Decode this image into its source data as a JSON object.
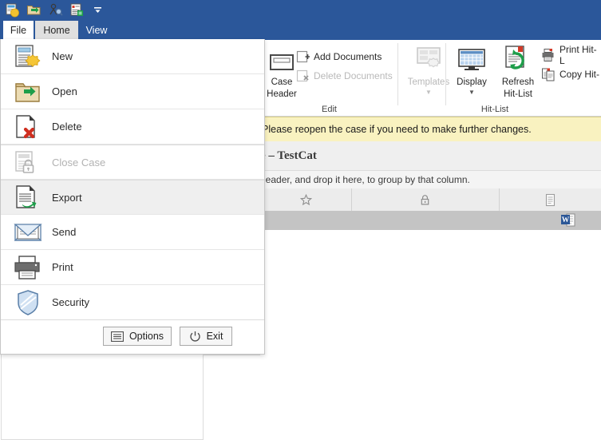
{
  "titlebar": {
    "quick_access": [
      {
        "name": "new-case-icon",
        "label": "New Case"
      },
      {
        "name": "open-case-icon",
        "label": "Open Case"
      },
      {
        "name": "search-person-icon",
        "label": "Search"
      },
      {
        "name": "report-icon",
        "label": "Report"
      },
      {
        "name": "customize-quick-access-icon",
        "label": "Customize Quick Access Toolbar"
      }
    ],
    "accent_color": "#2b579a"
  },
  "tabs": [
    {
      "id": "file",
      "label": "File",
      "state": "open"
    },
    {
      "id": "home",
      "label": "Home",
      "state": "selected"
    },
    {
      "id": "view",
      "label": "View",
      "state": "normal"
    }
  ],
  "ribbon": {
    "groups": [
      {
        "id": "edit",
        "label": "Edit",
        "big_buttons": [
          {
            "name": "case-header-button",
            "label_line1": "Case",
            "label_line2": "Header",
            "icon": "case-header-icon",
            "disabled": false
          }
        ],
        "small_buttons": [
          {
            "name": "add-documents-button",
            "label": "Add Documents",
            "icon": "add-document-icon",
            "disabled": false
          },
          {
            "name": "delete-documents-button",
            "label": "Delete Documents",
            "icon": "delete-document-icon",
            "disabled": true
          }
        ],
        "templates": {
          "name": "templates-button",
          "label": "Templates",
          "icon": "templates-icon",
          "disabled": true,
          "has_caret": true
        }
      },
      {
        "id": "hitlist",
        "label": "Hit-List",
        "big_buttons": [
          {
            "name": "display-button",
            "label_line1": "Display",
            "label_line2": "",
            "icon": "display-grid-icon",
            "disabled": false,
            "has_caret": true
          },
          {
            "name": "refresh-hit-list-button",
            "label_line1": "Refresh",
            "label_line2": "Hit-List",
            "icon": "refresh-hitlist-icon",
            "disabled": false
          }
        ],
        "small_buttons": [
          {
            "name": "print-hit-list-button",
            "label": "Print Hit-L",
            "icon": "printer-icon",
            "disabled": false
          },
          {
            "name": "copy-hit-list-button",
            "label": "Copy Hit-",
            "icon": "copy-icon",
            "disabled": false
          }
        ]
      }
    ]
  },
  "file_menu": {
    "items": [
      {
        "name": "menu-new",
        "label": "New",
        "icon": "new-document-icon",
        "disabled": false,
        "hover": false,
        "separator_above": false
      },
      {
        "name": "menu-open",
        "label": "Open",
        "icon": "open-folder-icon",
        "disabled": false,
        "hover": false,
        "separator_above": false
      },
      {
        "name": "menu-delete",
        "label": "Delete",
        "icon": "delete-document-icon",
        "disabled": false,
        "hover": false,
        "separator_above": false
      },
      {
        "name": "menu-close-case",
        "label": "Close Case",
        "icon": "close-case-lock-icon",
        "disabled": true,
        "hover": false,
        "separator_above": true
      },
      {
        "name": "menu-export",
        "label": "Export",
        "icon": "export-icon",
        "disabled": false,
        "hover": true,
        "separator_above": true
      },
      {
        "name": "menu-send",
        "label": "Send",
        "icon": "envelope-icon",
        "disabled": false,
        "hover": false,
        "separator_above": false
      },
      {
        "name": "menu-print",
        "label": "Print",
        "icon": "printer-icon",
        "disabled": false,
        "hover": false,
        "separator_above": false
      },
      {
        "name": "menu-security",
        "label": "Security",
        "icon": "shield-icon",
        "disabled": false,
        "hover": false,
        "separator_above": false
      }
    ],
    "footer": {
      "options_label": "Options",
      "exit_label": "Exit"
    }
  },
  "content": {
    "info_bar": {
      "message": "Please reopen the case if you need to make further changes.",
      "background": "#f9f2c0"
    },
    "case_title": "e – TestCat",
    "group_by_hint": "header, and drop it here, to group by that column.",
    "grid": {
      "columns": [
        {
          "name": "favorite-column",
          "icon": "star-icon",
          "header": ""
        },
        {
          "name": "locked-column",
          "icon": "lock-icon",
          "header": ""
        },
        {
          "name": "document-column",
          "icon": "document-icon",
          "header": ""
        }
      ],
      "rows": [
        {
          "name": "table-row",
          "selected": true,
          "doc_icon": "word-document-icon"
        }
      ]
    }
  }
}
